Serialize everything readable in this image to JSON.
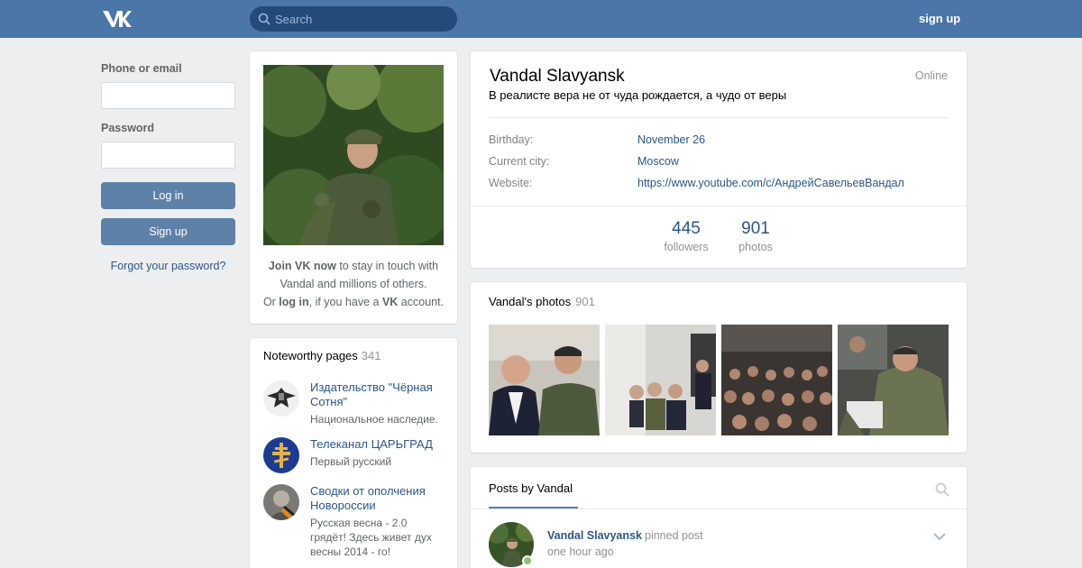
{
  "header": {
    "search_placeholder": "Search",
    "signup_label": "sign up"
  },
  "login": {
    "phone_label": "Phone or email",
    "password_label": "Password",
    "login_button": "Log in",
    "signup_button": "Sign up",
    "forgot_link": "Forgot your password?"
  },
  "join": {
    "join_vk_now": "Join VK now",
    "text1": " to stay in touch with Vandal and millions of others.",
    "or": "Or ",
    "log_in": "log in",
    "text2": ", if you have a ",
    "vk": "VK",
    "text3": " account."
  },
  "noteworthy": {
    "title": "Noteworthy pages",
    "count": "341",
    "items": [
      {
        "name": "Издательство \"Чёрная Сотня\"",
        "desc": "Национальное наследие."
      },
      {
        "name": "Телеканал ЦАРЬГРАД",
        "desc": "Первый русский"
      },
      {
        "name": "Сводки от ополчения Новороссии",
        "desc": "Русская весна - 2.0 грядёт! Здесь живет дух весны 2014 - го!"
      }
    ]
  },
  "profile": {
    "name": "Vandal Slavyansk",
    "online": "Online",
    "status": "В реалисте вера не от чуда рождается, а чудо от веры",
    "info": [
      {
        "label": "Birthday:",
        "value": "November 26"
      },
      {
        "label": "Current city:",
        "value": "Moscow"
      },
      {
        "label": "Website:",
        "value": "https://www.youtube.com/c/АндрейСавельевВандал"
      }
    ],
    "counters": [
      {
        "num": "445",
        "label": "followers"
      },
      {
        "num": "901",
        "label": "photos"
      }
    ]
  },
  "photos": {
    "title": "Vandal's photos",
    "count": "901"
  },
  "posts": {
    "tab": "Posts by Vandal",
    "author": "Vandal Slavyansk",
    "pinned": "pinned post",
    "time": "one hour ago"
  },
  "colors": {
    "header": "#4a76a8",
    "link": "#2a5885",
    "button": "#5e81a8",
    "background": "#edeef0"
  }
}
